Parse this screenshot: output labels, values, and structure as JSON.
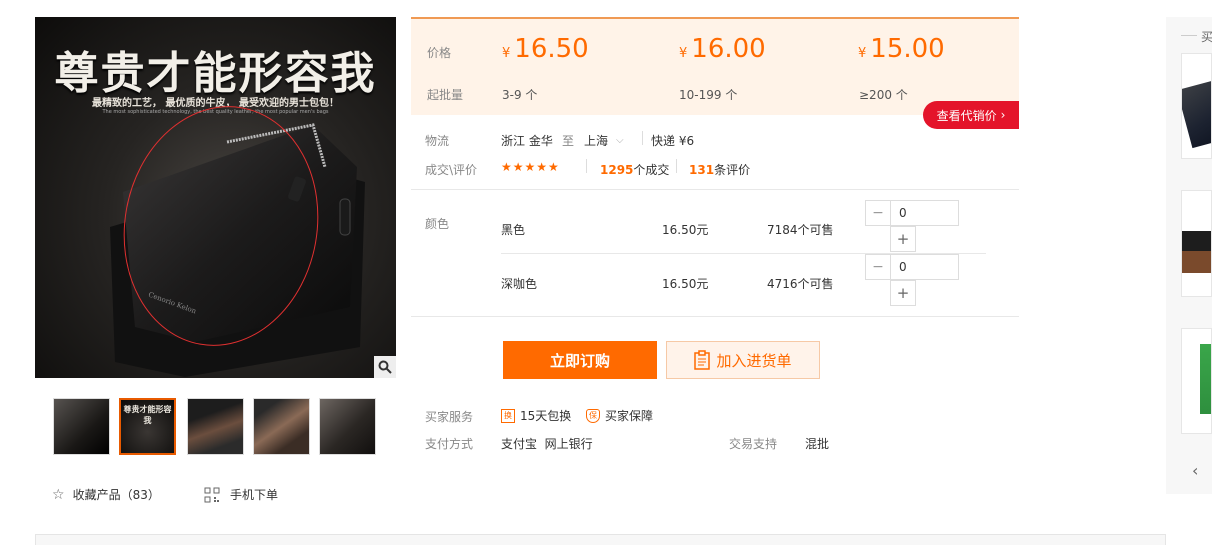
{
  "gallery": {
    "headline": "尊贵才能形容我",
    "tagline": "最精致的工艺， 最优质的牛皮， 最受欢迎的男士包包！",
    "tagline_en": "The most sophisticated technology, the best quality leather, the most popular men's bags",
    "brand_on_wallet": "Cenorio Kelon",
    "thumbnail_count": 5,
    "active_thumbnail": 2
  },
  "actions": {
    "favorite_label": "收藏产品",
    "favorite_count": "（83）",
    "mobile_order_label": "手机下单"
  },
  "pricing": {
    "price_label": "价格",
    "min_qty_label": "起批量",
    "currency": "¥",
    "tiers": [
      {
        "price": "16.50",
        "qty": "3-9 个"
      },
      {
        "price": "16.00",
        "qty": "10-199 个"
      },
      {
        "price": "15.00",
        "qty": "≥200 个"
      }
    ],
    "agent_price_button": "查看代销价"
  },
  "logistics": {
    "label": "物流",
    "from": "浙江 金华",
    "to_word": "至",
    "to": "上海",
    "shipping": "快递 ¥6"
  },
  "reviews": {
    "label": "成交\\评价",
    "stars": "★★★★★",
    "deals_count": "1295",
    "deals_suffix": "个成交",
    "review_count": "131",
    "review_suffix": "条评价"
  },
  "variants": {
    "label": "颜色",
    "items": [
      {
        "name": "黑色",
        "price": "16.50元",
        "stock": "7184个可售",
        "qty": "0"
      },
      {
        "name": "深咖色",
        "price": "16.50元",
        "stock": "4716个可售",
        "qty": "0"
      }
    ]
  },
  "buttons": {
    "order_now": "立即订购",
    "add_to_cart": "加入进货单"
  },
  "services": {
    "buyer_service_label": "买家服务",
    "exchange_icon": "换",
    "exchange": "15天包换",
    "guarantee_icon": "保",
    "guarantee": "买家保障",
    "payment_label": "支付方式",
    "payment_methods": "支付宝  网上银行",
    "trade_support_label": "交易支持",
    "trade_support": "混批"
  },
  "sidebar": {
    "header": "买"
  },
  "colors": {
    "accent": "#ff6a00",
    "price_bg": "#fff3e8",
    "agent_btn": "#e4142a"
  }
}
